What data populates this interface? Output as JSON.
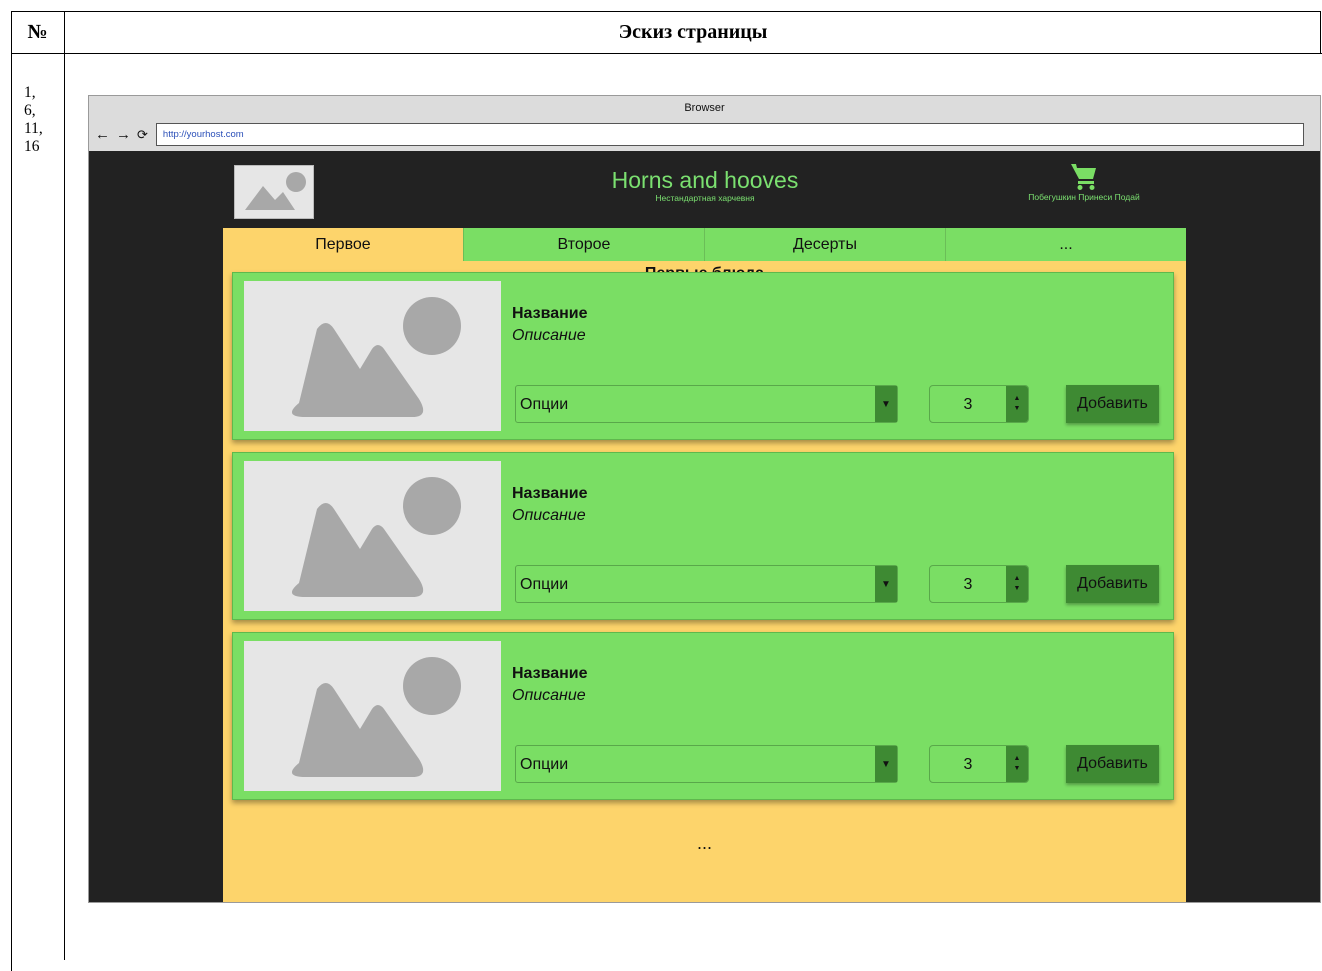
{
  "table": {
    "col_num_header": "№",
    "col_title_header": "Эскиз страницы",
    "row_numbers": [
      "1,",
      "6,",
      "11,",
      "16"
    ]
  },
  "browser": {
    "window_title": "Browser",
    "url": "http://yourhost.com",
    "nav_icons": [
      "back-arrow-icon",
      "forward-arrow-icon",
      "reload-icon"
    ]
  },
  "site": {
    "brand_name": "Horns and hooves",
    "brand_subtitle": "Нестандартная харчевня",
    "cart_label": "Побегушкин Принеси Подай",
    "accent_color": "#7ade64",
    "panel_color": "#fdd46b",
    "dark_button_color": "#3e8a33",
    "tabs": [
      {
        "label": "Первое",
        "active": true
      },
      {
        "label": "Второе",
        "active": false
      },
      {
        "label": "Десерты",
        "active": false
      },
      {
        "label": "...",
        "active": false
      }
    ],
    "section_title": "Первые блюда",
    "items": [
      {
        "name": "Название",
        "description": "Описание",
        "options": "Опции",
        "quantity": "3",
        "add_label": "Добавить"
      },
      {
        "name": "Название",
        "description": "Описание",
        "options": "Опции",
        "quantity": "3",
        "add_label": "Добавить"
      },
      {
        "name": "Название",
        "description": "Описание",
        "options": "Опции",
        "quantity": "3",
        "add_label": "Добавить"
      }
    ],
    "more_label": "..."
  }
}
